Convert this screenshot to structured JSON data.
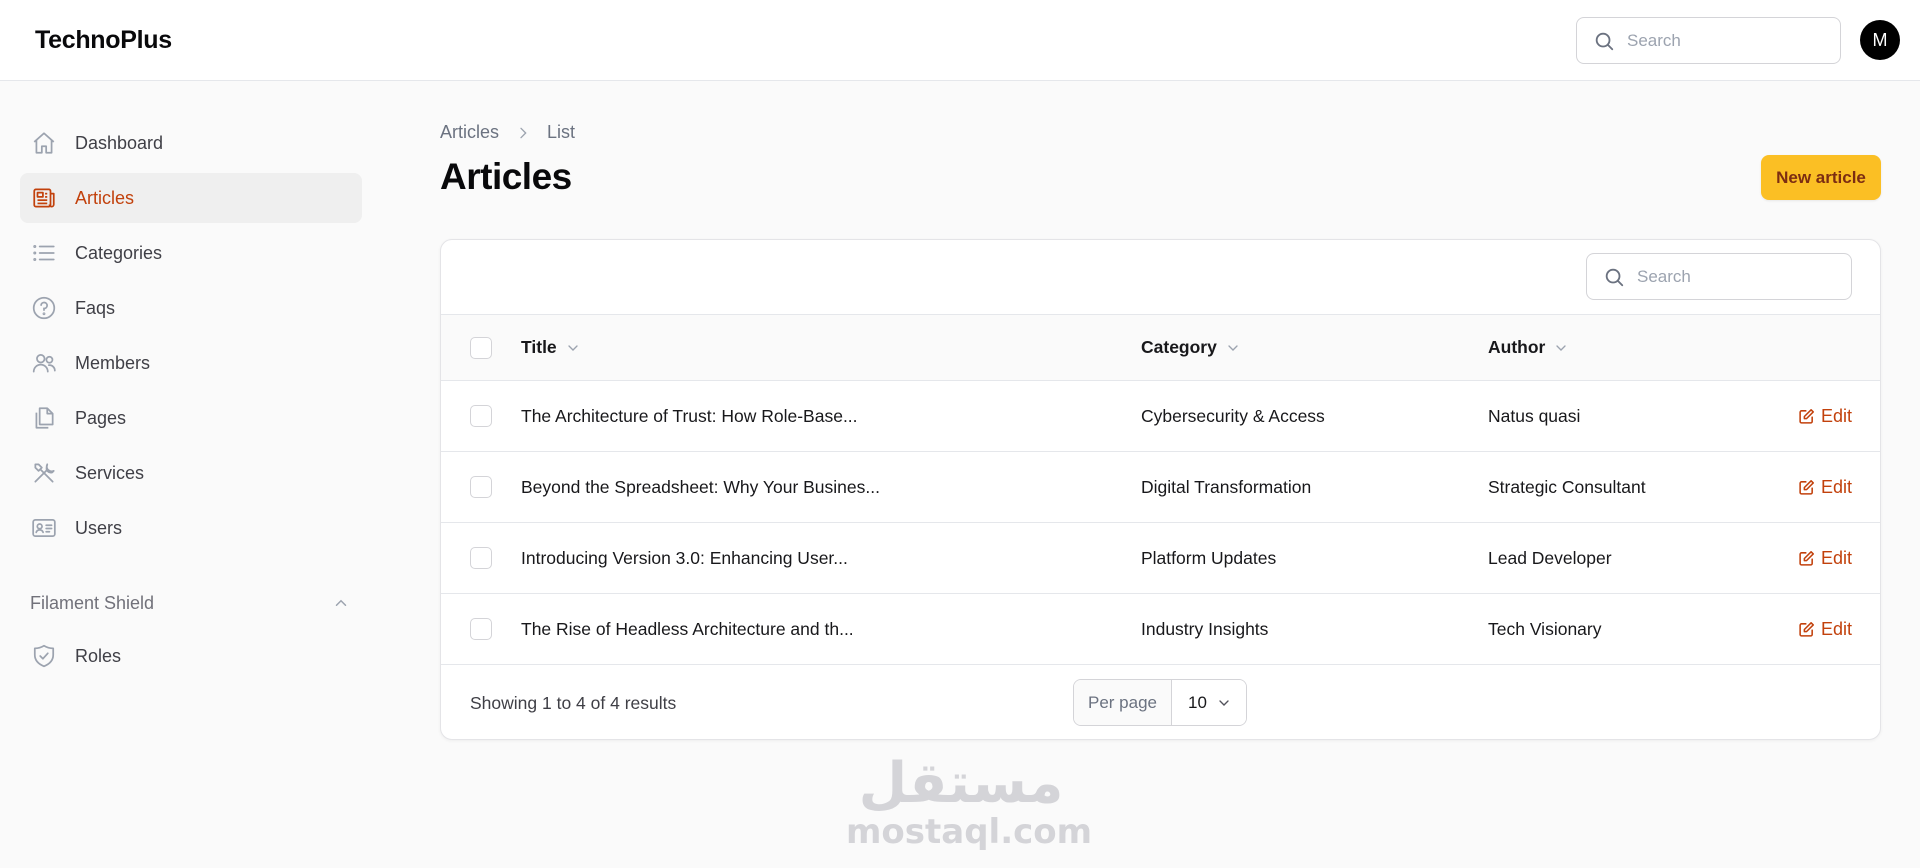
{
  "app": {
    "brand": "TechnoPlus",
    "avatar_initial": "M"
  },
  "topbar": {
    "search_placeholder": "Search"
  },
  "sidebar": {
    "items": [
      {
        "label": "Dashboard",
        "icon": "home-icon"
      },
      {
        "label": "Articles",
        "icon": "newspaper-icon",
        "active": true
      },
      {
        "label": "Categories",
        "icon": "list-icon"
      },
      {
        "label": "Faqs",
        "icon": "question-circle-icon"
      },
      {
        "label": "Members",
        "icon": "users-icon"
      },
      {
        "label": "Pages",
        "icon": "documents-icon"
      },
      {
        "label": "Services",
        "icon": "tools-icon"
      },
      {
        "label": "Users",
        "icon": "id-card-icon"
      }
    ],
    "groups": [
      {
        "label": "Filament Shield",
        "items": [
          {
            "label": "Roles",
            "icon": "shield-check-icon"
          }
        ]
      }
    ]
  },
  "breadcrumb": {
    "parent": "Articles",
    "current": "List"
  },
  "page": {
    "title": "Articles",
    "new_button": "New article"
  },
  "table": {
    "search_placeholder": "Search",
    "columns": [
      "Title",
      "Category",
      "Author"
    ],
    "rows": [
      {
        "title": "The Architecture of Trust: How Role-Base...",
        "category": "Cybersecurity & Access",
        "author": "Natus quasi",
        "action": "Edit"
      },
      {
        "title": "Beyond the Spreadsheet: Why Your Busines...",
        "category": "Digital Transformation",
        "author": "Strategic Consultant",
        "action": "Edit"
      },
      {
        "title": "Introducing Version 3.0: Enhancing User...",
        "category": "Platform Updates",
        "author": "Lead Developer",
        "action": "Edit"
      },
      {
        "title": "The Rise of Headless Architecture and th...",
        "category": "Industry Insights",
        "author": "Tech Visionary",
        "action": "Edit"
      }
    ],
    "footer": {
      "results": "Showing 1 to 4 of 4 results",
      "per_page_label": "Per page",
      "per_page_value": "10"
    }
  },
  "watermark": {
    "arabic": "مستقل",
    "latin": "mostaql.com"
  },
  "colors": {
    "accent": "#c2410c",
    "primary_button": "#fbbf24"
  }
}
